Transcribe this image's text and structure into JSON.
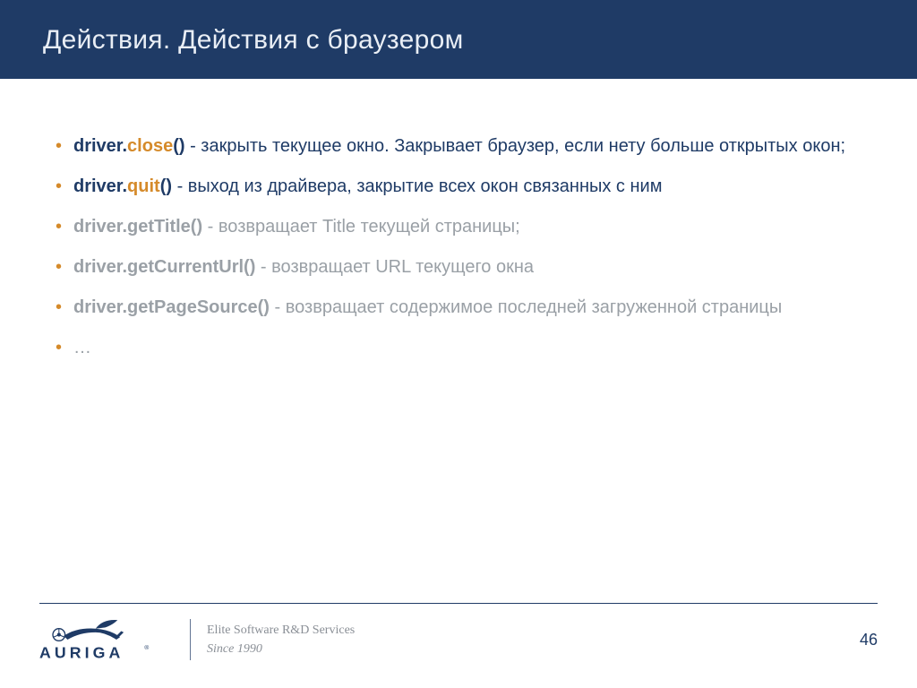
{
  "title": "Действия. Действия с браузером",
  "bullets": [
    {
      "dim": false,
      "prefix": "driver.",
      "accent": "close",
      "suffix": "()",
      "text": " - закрыть текущее окно. Закрывает браузер, если нету больше открытых окон;"
    },
    {
      "dim": false,
      "prefix": "driver.",
      "accent": "quit",
      "suffix": "()",
      "text": " - выход из драйвера, закрытие всех окон связанных с ним"
    },
    {
      "dim": true,
      "prefix": "driver.getTitle()",
      "accent": "",
      "suffix": "",
      "text": " - возвращает Title текущей страницы;"
    },
    {
      "dim": true,
      "prefix": "driver.getCurrentUrl()",
      "accent": "",
      "suffix": "",
      "text": " - возвращает URL текущего окна"
    },
    {
      "dim": true,
      "prefix": "driver.getPageSource()",
      "accent": "",
      "suffix": "",
      "text": " - возвращает содержимое последней загруженной страницы"
    },
    {
      "dim": true,
      "prefix": "…",
      "accent": "",
      "suffix": "",
      "text": ""
    }
  ],
  "footer": {
    "brand_name": "AURIGA",
    "tagline_line1": "Elite Software R&D Services",
    "tagline_line2": "Since 1990",
    "page_number": "46"
  }
}
